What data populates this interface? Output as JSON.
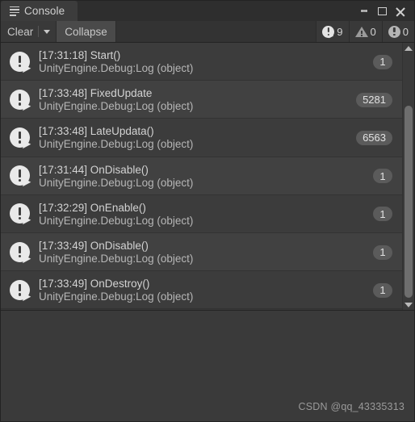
{
  "window": {
    "tab_label": "Console",
    "tab_icon": "console-lines-icon",
    "controls": {
      "menu": "kebab-menu-icon",
      "maximize": "maximize-icon",
      "close": "close-icon"
    }
  },
  "toolbar": {
    "clear_label": "Clear",
    "clear_dropdown_icon": "chevron-down-icon",
    "collapse_label": "Collapse",
    "search_value": "",
    "search_placeholder": "",
    "counters": [
      {
        "icon": "log-bubble-icon",
        "count": "9"
      },
      {
        "icon": "warning-triangle-icon",
        "count": "0"
      },
      {
        "icon": "error-circle-icon",
        "count": "0"
      }
    ]
  },
  "console": {
    "entries": [
      {
        "icon": "log-bubble-icon",
        "message": "[17:31:18] Start()",
        "stacktrace": "UnityEngine.Debug:Log (object)",
        "count": "1"
      },
      {
        "icon": "log-bubble-icon",
        "message": "[17:33:48] FixedUpdate",
        "stacktrace": "UnityEngine.Debug:Log (object)",
        "count": "5281"
      },
      {
        "icon": "log-bubble-icon",
        "message": "[17:33:48] LateUpdata()",
        "stacktrace": "UnityEngine.Debug:Log (object)",
        "count": "6563"
      },
      {
        "icon": "log-bubble-icon",
        "message": "[17:31:44] OnDisable()",
        "stacktrace": "UnityEngine.Debug:Log (object)",
        "count": "1"
      },
      {
        "icon": "log-bubble-icon",
        "message": "[17:32:29] OnEnable()",
        "stacktrace": "UnityEngine.Debug:Log (object)",
        "count": "1"
      },
      {
        "icon": "log-bubble-icon",
        "message": "[17:33:49] OnDisable()",
        "stacktrace": "UnityEngine.Debug:Log (object)",
        "count": "1"
      },
      {
        "icon": "log-bubble-icon",
        "message": "[17:33:49] OnDestroy()",
        "stacktrace": "UnityEngine.Debug:Log (object)",
        "count": "1"
      }
    ]
  },
  "detail": {
    "text": "",
    "watermark": "CSDN @qq_43335313"
  },
  "colors": {
    "window_bg": "#383838",
    "tab_active": "#3c3c3c",
    "toolbar_bg": "#393939",
    "row_a": "#3c3c3c",
    "row_b": "#414141",
    "badge": "#5b5b5b",
    "text_primary": "#d3d3d3",
    "text_secondary": "#b6b6b6",
    "scrollbar_thumb": "#6e6e6e"
  }
}
